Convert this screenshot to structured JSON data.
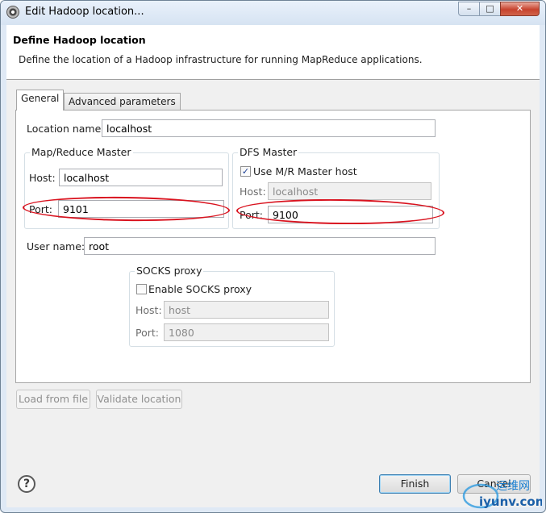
{
  "window": {
    "title": "Edit Hadoop location...",
    "controls": {
      "minimize": "–",
      "maximize": "□",
      "close": "✕"
    }
  },
  "header": {
    "title": "Define Hadoop location",
    "description": "Define the location of a Hadoop infrastructure for running MapReduce applications."
  },
  "tabs": [
    {
      "label": "General",
      "active": true
    },
    {
      "label": "Advanced parameters",
      "active": false
    }
  ],
  "general": {
    "location_name_label": "Location name:",
    "location_name_value": "localhost",
    "mapreduce_master": {
      "legend": "Map/Reduce Master",
      "host_label": "Host:",
      "host_value": "localhost",
      "port_label": "Port:",
      "port_value": "9101"
    },
    "dfs_master": {
      "legend": "DFS Master",
      "use_mr_label": "Use M/R Master host",
      "use_mr_checked": true,
      "host_label": "Host:",
      "host_value": "localhost",
      "port_label": "Port:",
      "port_value": "9100"
    },
    "user_name_label": "User name:",
    "user_name_value": "root",
    "socks_proxy": {
      "legend": "SOCKS proxy",
      "enable_label": "Enable SOCKS proxy",
      "enable_checked": false,
      "host_label": "Host:",
      "host_value": "host",
      "port_label": "Port:",
      "port_value": "1080"
    }
  },
  "actions": {
    "load_from_file": "Load from file",
    "validate_location": "Validate location"
  },
  "footer": {
    "help_glyph": "?",
    "finish": "Finish",
    "cancel": "Cancel"
  },
  "watermark": {
    "line1": "运维网",
    "line2": "iyunv.com"
  },
  "colors": {
    "highlight_ring": "#d9131f",
    "checkbox_mark": "#1c3f94",
    "default_button_border": "#3c7fb1"
  }
}
